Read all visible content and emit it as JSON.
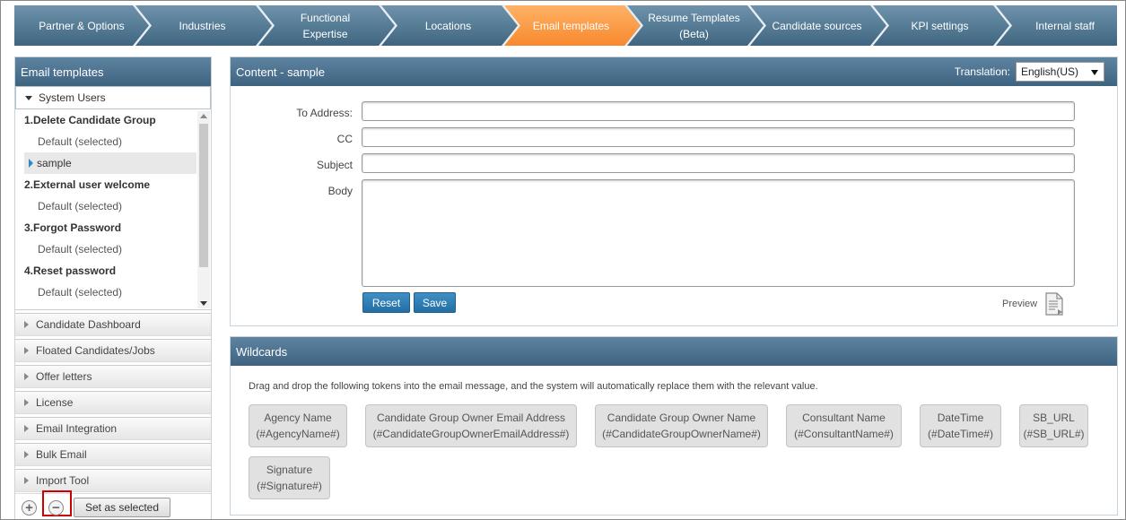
{
  "wizard": {
    "steps": [
      {
        "label": "Partner & Options",
        "active": false
      },
      {
        "label": "Industries",
        "active": false
      },
      {
        "label": "Functional\nExpertise",
        "active": false
      },
      {
        "label": "Locations",
        "active": false
      },
      {
        "label": "Email templates",
        "active": true
      },
      {
        "label": "Resume Templates\n(Beta)",
        "active": false
      },
      {
        "label": "Candidate sources",
        "active": false
      },
      {
        "label": "KPI settings",
        "active": false
      },
      {
        "label": "Internal staff",
        "active": false
      }
    ],
    "colors": {
      "normal": "#4e7592",
      "active": "#f7892e"
    }
  },
  "left": {
    "title": "Email templates",
    "open_group": "System Users",
    "items": [
      {
        "label": "1.Delete Candidate Group",
        "kind": "header"
      },
      {
        "label": "Default  (selected)",
        "kind": "sub"
      },
      {
        "label": "sample",
        "kind": "selected"
      },
      {
        "label": "2.External user welcome",
        "kind": "header"
      },
      {
        "label": "Default  (selected)",
        "kind": "sub"
      },
      {
        "label": "3.Forgot Password",
        "kind": "header"
      },
      {
        "label": "Default  (selected)",
        "kind": "sub"
      },
      {
        "label": "4.Reset password",
        "kind": "header"
      },
      {
        "label": "Default  (selected)",
        "kind": "sub"
      }
    ],
    "groups": [
      "Candidate Dashboard",
      "Floated Candidates/Jobs",
      "Offer letters",
      "License",
      "Email Integration",
      "Bulk Email",
      "Import Tool"
    ],
    "footer": {
      "add_icon": "plus-circle-icon",
      "remove_icon": "minus-circle-icon",
      "set_selected": "Set as selected"
    }
  },
  "content": {
    "title": "Content - sample",
    "translation_label": "Translation:",
    "translation_value": "English(US)",
    "to_label": "To Address:",
    "cc_label": "CC",
    "subject_label": "Subject",
    "body_label": "Body",
    "to_value": "",
    "cc_value": "",
    "subject_value": "",
    "body_value": "",
    "reset": "Reset",
    "save": "Save",
    "preview": "Preview",
    "accent": "#2b7db8"
  },
  "wildcards": {
    "title": "Wildcards",
    "description": "Drag and drop the following tokens into the email message, and the system will automatically replace them with the relevant value.",
    "tokens": [
      {
        "name": "Agency Name",
        "token": "(#AgencyName#)"
      },
      {
        "name": "Candidate Group Owner Email Address",
        "token": "(#CandidateGroupOwnerEmailAddress#)"
      },
      {
        "name": "Candidate Group Owner Name",
        "token": "(#CandidateGroupOwnerName#)"
      },
      {
        "name": "Consultant Name",
        "token": "(#ConsultantName#)"
      },
      {
        "name": "DateTime",
        "token": "(#DateTime#)"
      },
      {
        "name": "SB_URL",
        "token": "(#SB_URL#)"
      },
      {
        "name": "Signature",
        "token": "(#Signature#)"
      }
    ]
  }
}
